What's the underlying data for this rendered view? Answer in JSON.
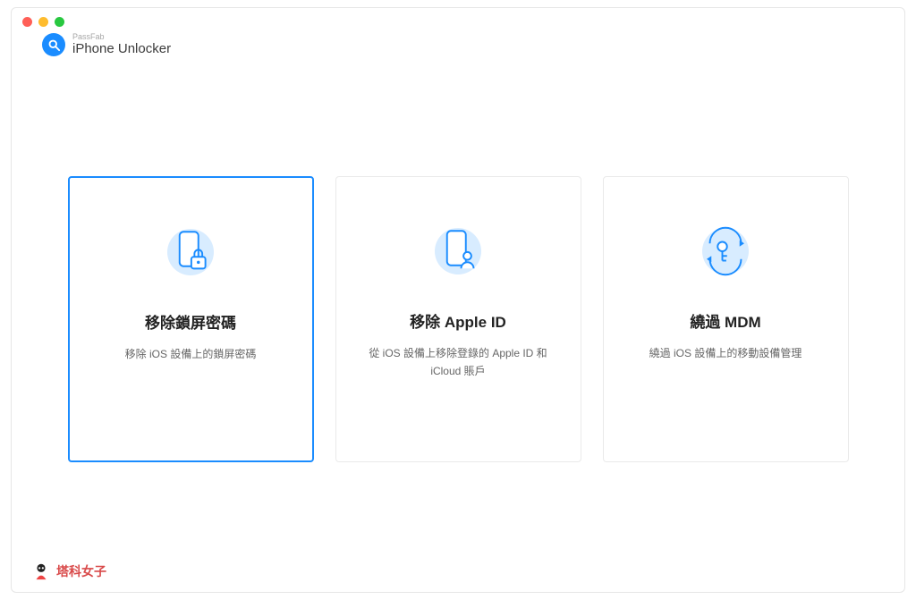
{
  "brand": {
    "small": "PassFab",
    "name": "iPhone Unlocker"
  },
  "cards": [
    {
      "title": "移除鎖屏密碼",
      "desc": "移除 iOS 設備上的鎖屏密碼"
    },
    {
      "title": "移除 Apple ID",
      "desc": "從 iOS 設備上移除登錄的 Apple ID 和 iCloud 賬戶"
    },
    {
      "title": "繞過 MDM",
      "desc": "繞過 iOS 設備上的移動設備管理"
    }
  ],
  "footer": {
    "site": "塔科女子"
  },
  "colors": {
    "accent": "#1a8cff",
    "iconBg": "#d8ecff"
  }
}
